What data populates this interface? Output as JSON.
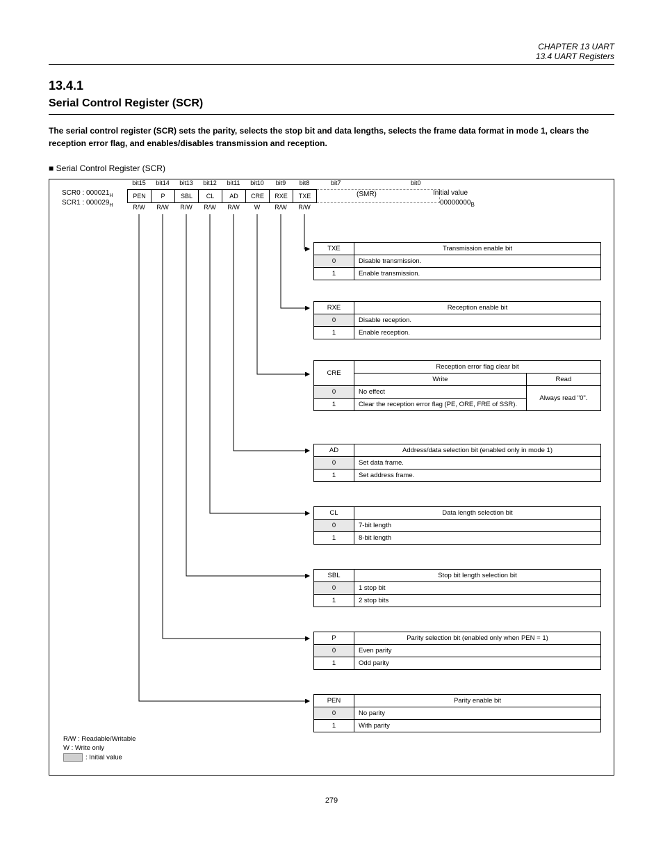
{
  "header": {
    "right1": "CHAPTER 13  UART",
    "right2": "13.4  UART Registers"
  },
  "section": {
    "number": "13.4.1",
    "title": "Serial Control Register (SCR)",
    "intro": "The serial control register (SCR) sets the parity, selects the stop bit and data lengths, selects the frame data format in mode 1, clears the reception error flag, and enables/disables transmission and reception."
  },
  "figure_label": "■  Serial Control Register (SCR)",
  "register": {
    "addr1": "SCR0 : 000021",
    "addr2": "SCR1 : 000029",
    "addr_sub": "H",
    "bitnums": [
      "bit15",
      "bit14",
      "bit13",
      "bit12",
      "bit11",
      "bit10",
      "bit9",
      "bit8"
    ],
    "bit7": "bit7",
    "bit0": "bit0",
    "bits": [
      "PEN",
      "P",
      "SBL",
      "CL",
      "AD",
      "CRE",
      "RXE",
      "TXE"
    ],
    "smr": "(SMR)",
    "rw": [
      "R/W",
      "R/W",
      "R/W",
      "R/W",
      "R/W",
      "W",
      "R/W",
      "R/W"
    ],
    "initlabel": "Initial value",
    "initval": "00000000",
    "initval_sub": "B"
  },
  "tables": {
    "txe": {
      "name": "TXE",
      "title": "Transmission enable bit",
      "r0": "0",
      "v0": "Disable transmission.",
      "r1": "1",
      "v1": "Enable transmission."
    },
    "rxe": {
      "name": "RXE",
      "title": "Reception enable bit",
      "r0": "0",
      "v0": "Disable reception.",
      "r1": "1",
      "v1": "Enable reception."
    },
    "cre": {
      "name": "CRE",
      "title": "Reception error flag clear bit",
      "w": "Write",
      "r": "Read",
      "r0": "0",
      "w0": "No effect",
      "r1": "1",
      "w1": "Clear the reception error flag (PE, ORE, FRE of SSR).",
      "rread": "Always read \"0\"."
    },
    "ad": {
      "name": "AD",
      "title": "Address/data selection bit (enabled only in mode 1)",
      "r0": "0",
      "v0": "Set data frame.",
      "r1": "1",
      "v1": "Set address frame."
    },
    "cl": {
      "name": "CL",
      "title": "Data length selection bit",
      "r0": "0",
      "v0": "7-bit length",
      "r1": "1",
      "v1": "8-bit length"
    },
    "sbl": {
      "name": "SBL",
      "title": "Stop bit length selection bit",
      "r0": "0",
      "v0": "1 stop bit",
      "r1": "1",
      "v1": "2 stop bits"
    },
    "p": {
      "name": "P",
      "title": "Parity selection bit (enabled only when PEN = 1)",
      "r0": "0",
      "v0": "Even parity",
      "r1": "1",
      "v1": "Odd parity"
    },
    "pen": {
      "name": "PEN",
      "title": "Parity enable bit",
      "r0": "0",
      "v0": "No parity",
      "r1": "1",
      "v1": "With parity"
    }
  },
  "legend": {
    "rw": "R/W : Readable/Writable",
    "w": "W    : Write only",
    "init": ": Initial value"
  },
  "footer": "279"
}
